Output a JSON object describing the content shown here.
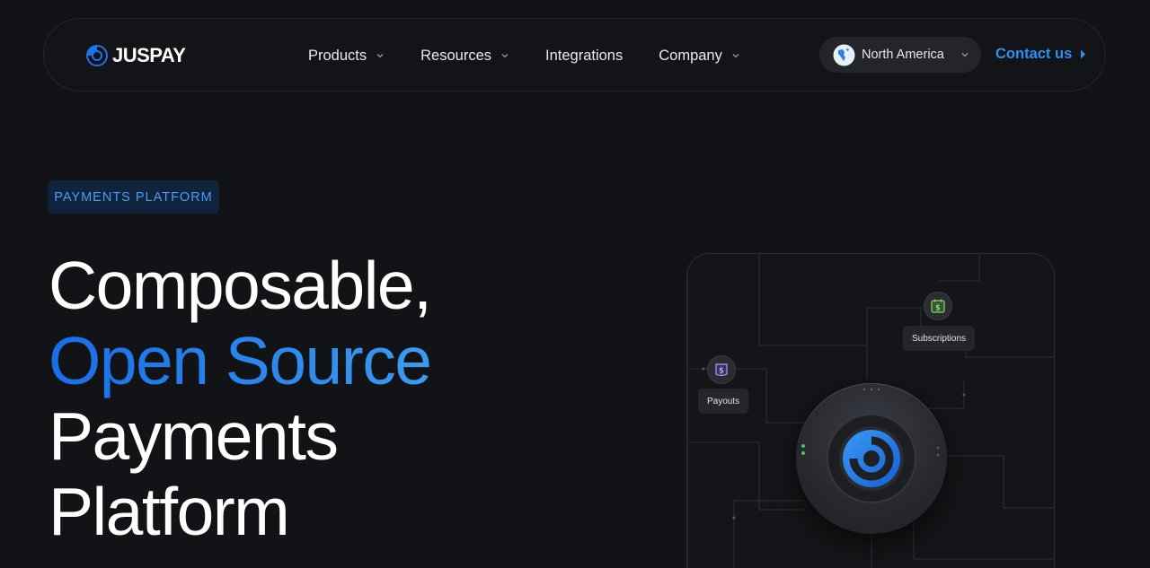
{
  "brand": {
    "name": "JUSPAY",
    "accent": "#2e8ff5"
  },
  "nav": {
    "items": [
      {
        "label": "Products",
        "has_dropdown": true
      },
      {
        "label": "Resources",
        "has_dropdown": true
      },
      {
        "label": "Integrations",
        "has_dropdown": false
      },
      {
        "label": "Company",
        "has_dropdown": true
      }
    ],
    "region": {
      "label": "North America",
      "icon": "globe-icon"
    },
    "contact_label": "Contact us"
  },
  "hero": {
    "badge": "PAYMENTS PLATFORM",
    "headline_line1": "Composable,",
    "headline_line2": "Open Source",
    "headline_line3": "Payments",
    "headline_line4": "Platform"
  },
  "visual": {
    "nodes": [
      {
        "label": "Subscriptions",
        "icon": "calendar-dollar-icon"
      },
      {
        "label": "Payouts",
        "icon": "dollar-bag-icon"
      }
    ],
    "hub_icon": "juspay-logo-icon"
  }
}
